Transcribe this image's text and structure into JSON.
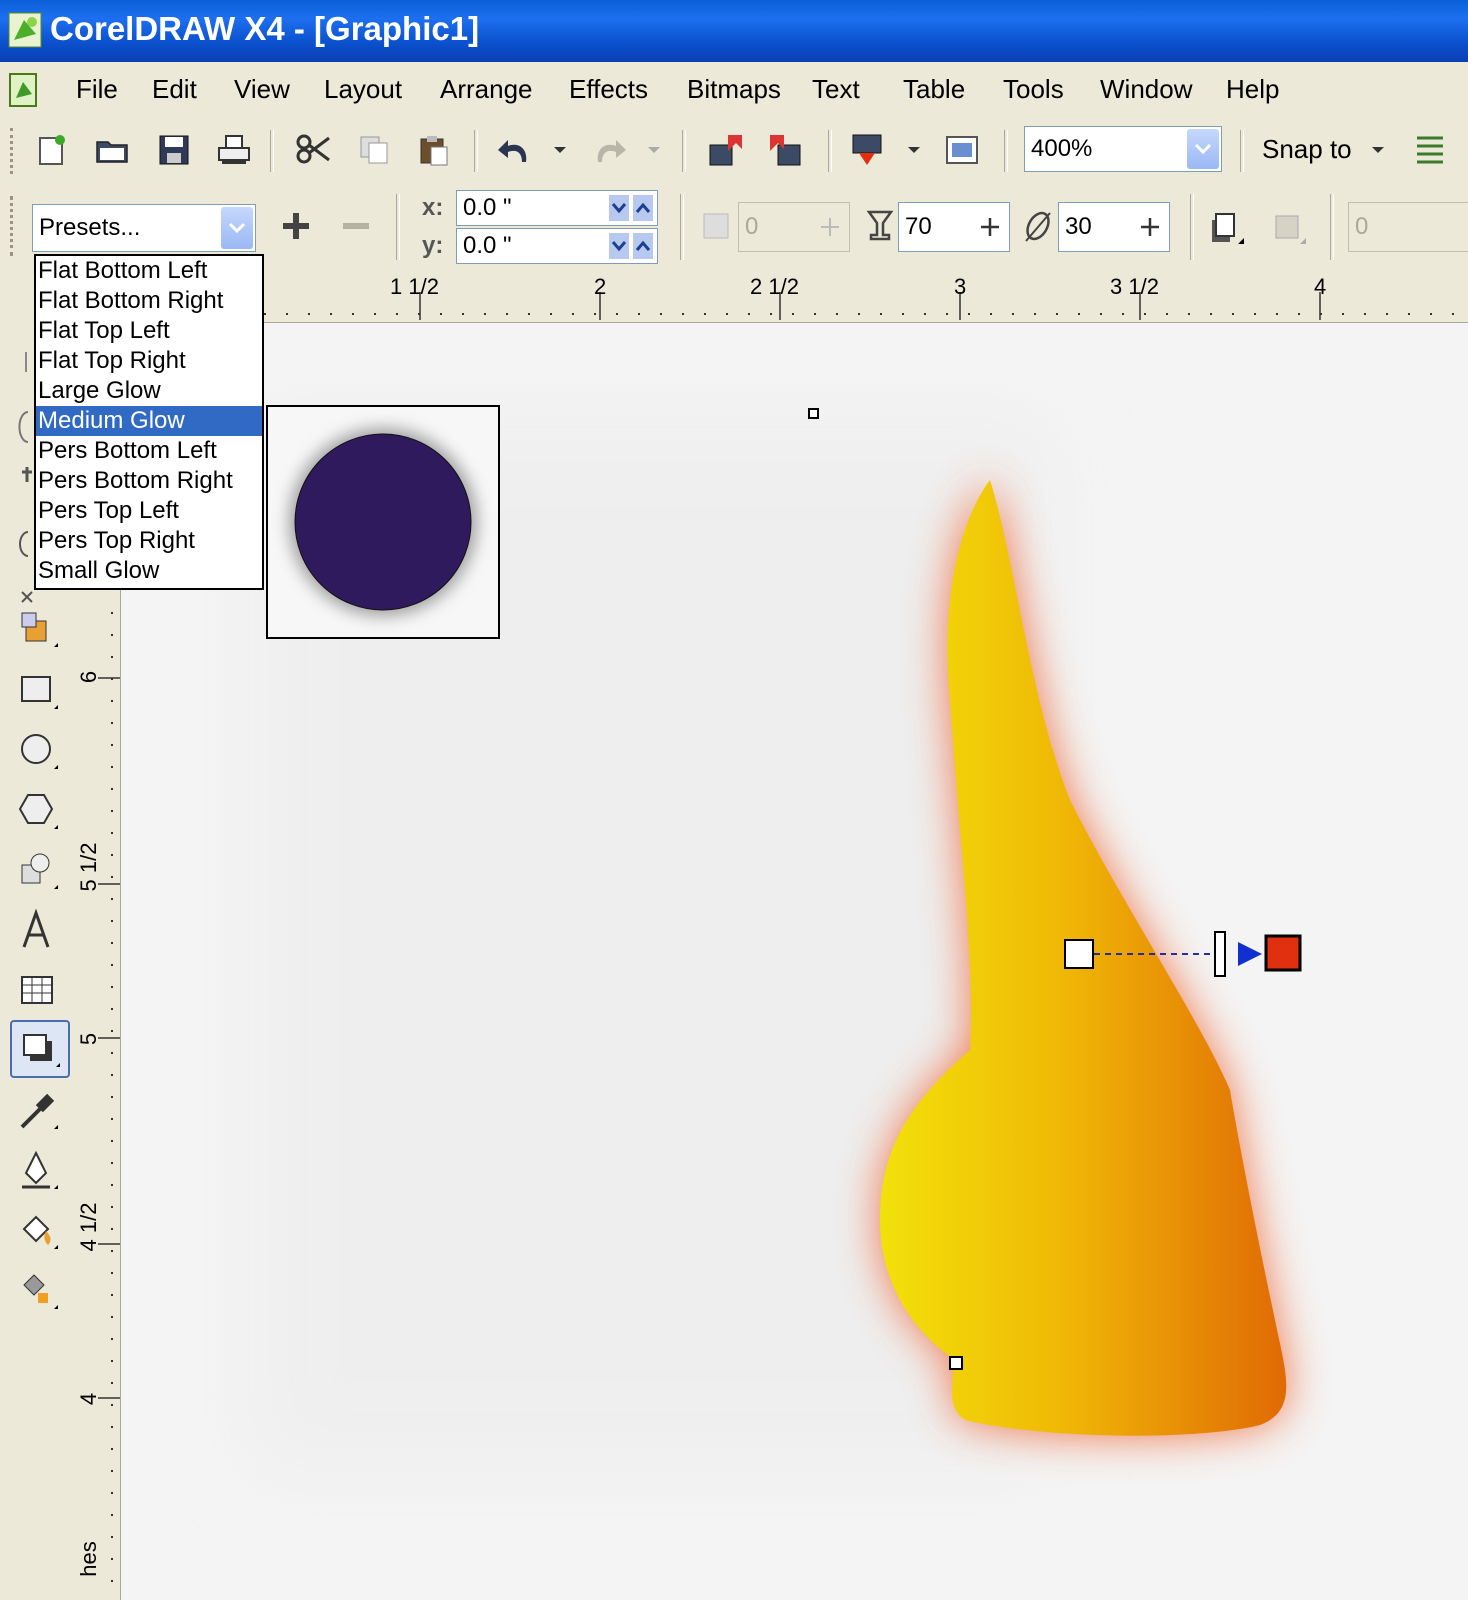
{
  "window": {
    "title": "CorelDRAW X4 - [Graphic1]"
  },
  "menu": [
    "File",
    "Edit",
    "View",
    "Layout",
    "Arrange",
    "Effects",
    "Bitmaps",
    "Text",
    "Table",
    "Tools",
    "Window",
    "Help"
  ],
  "standard_toolbar": {
    "zoom": "400%",
    "snap_label": "Snap to"
  },
  "property_bar": {
    "presets_label": "Presets...",
    "x_label": "x:",
    "x_value": "0.0 \"",
    "y_label": "y:",
    "y_value": "0.0 \"",
    "offset_value": "0",
    "opacity_value": "70",
    "feather_value": "30",
    "right_value": "0"
  },
  "presets": {
    "options": [
      "Flat Bottom Left",
      "Flat Bottom Right",
      "Flat Top Left",
      "Flat Top Right",
      "Large Glow",
      "Medium Glow",
      "Pers Bottom Left",
      "Pers Bottom Right",
      "Pers Top Left",
      "Pers Top Right",
      "Small Glow"
    ],
    "selected": "Medium Glow"
  },
  "ruler": {
    "horizontal_labels": [
      "1 1/2",
      "2",
      "2 1/2",
      "3",
      "3 1/2",
      "4"
    ],
    "vertical_labels": [
      "6",
      "5 1/2",
      "5",
      "4 1/2",
      "4"
    ],
    "unit_fragment": "hes"
  },
  "colors": {
    "selection": "#316ac5",
    "preview_circle": "#2e1a5c",
    "shape_yellow": "#f2e10a",
    "shape_orange": "#e06a05",
    "glow": "#f06a3a",
    "shadow_end_handle": "#e03010"
  }
}
